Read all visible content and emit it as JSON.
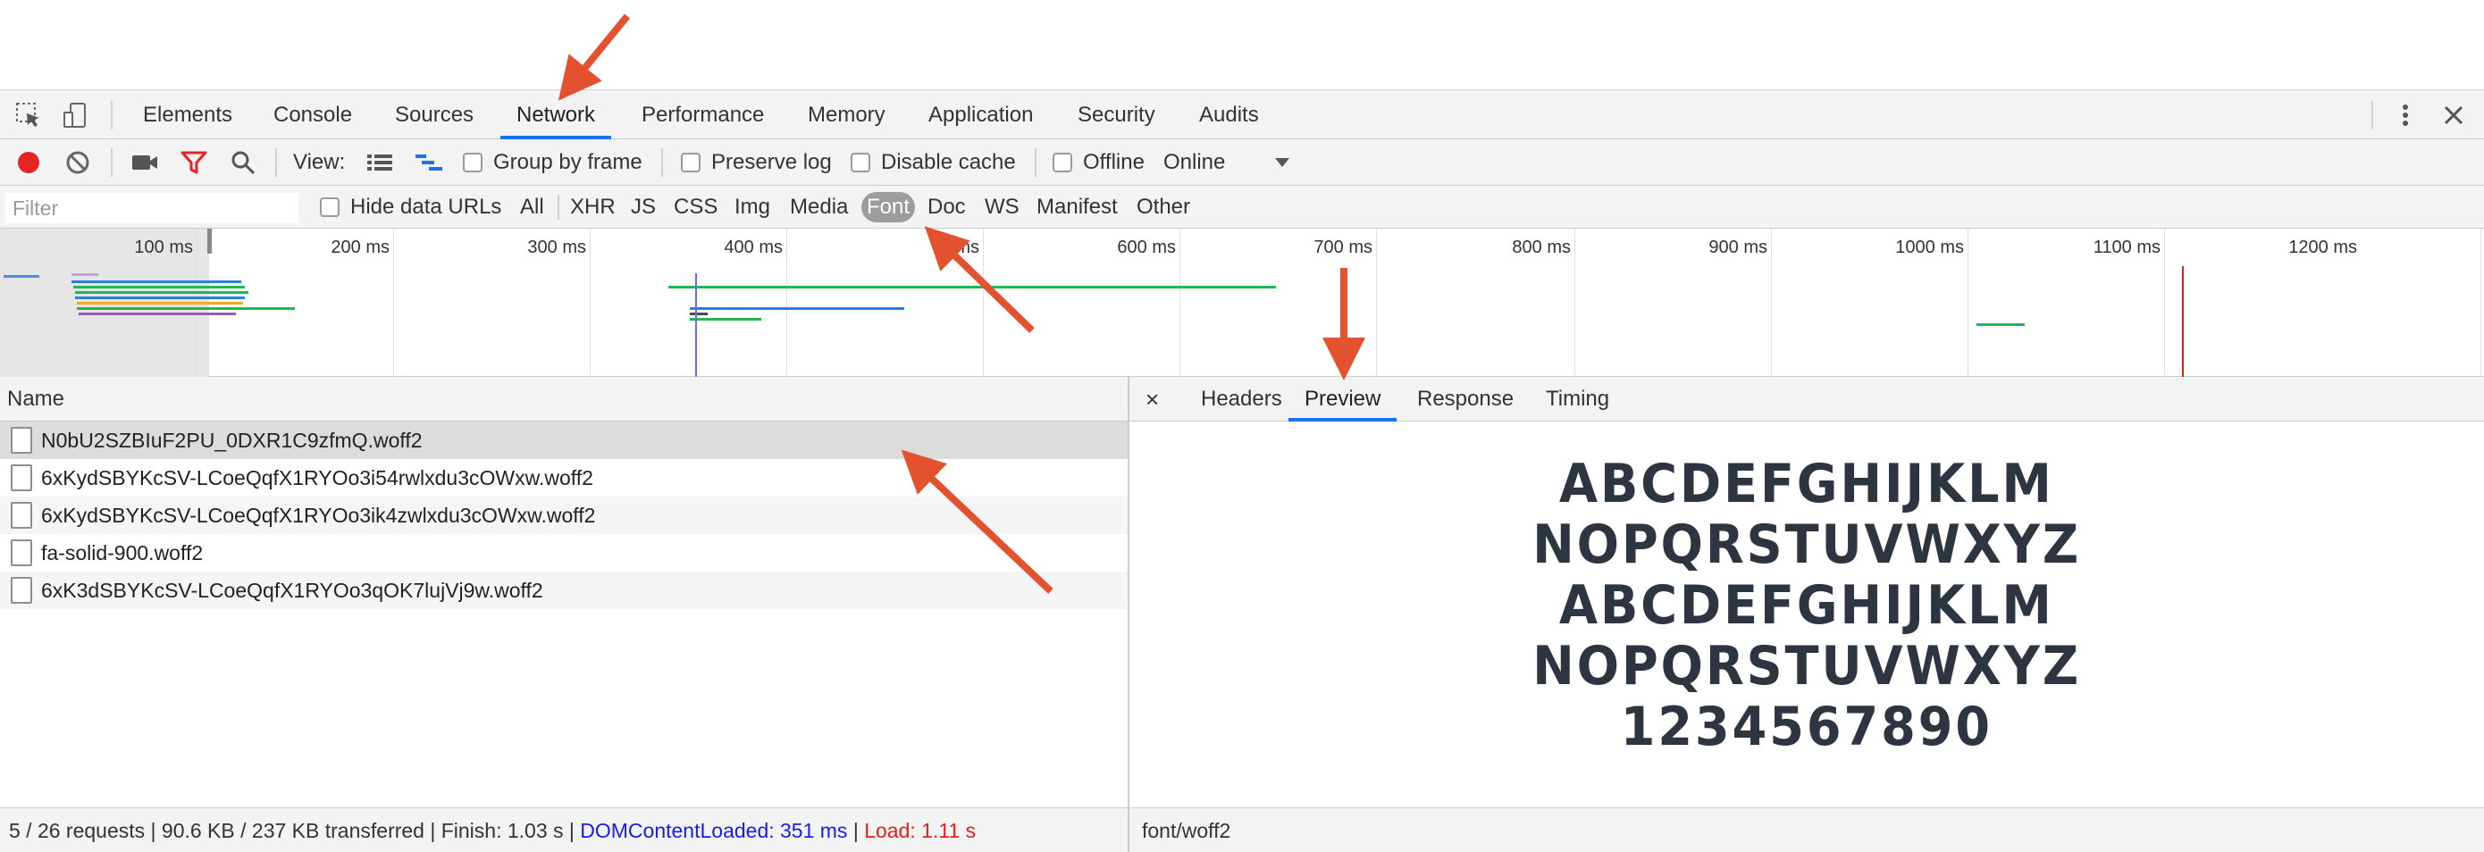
{
  "colors": {
    "accent": "#1a73e8",
    "arrow": "#e4512f",
    "record": "#e52424",
    "filter_active": "#e52424"
  },
  "icons": [
    "inspect-icon",
    "device-toggle-icon",
    "record-icon",
    "clear-icon",
    "camera-icon",
    "filter-icon",
    "search-icon",
    "list-view-icon",
    "waterfall-view-icon",
    "more-vert-icon",
    "close-icon",
    "dropdown-icon",
    "file-icon"
  ],
  "devtools_tabs": [
    "Elements",
    "Console",
    "Sources",
    "Network",
    "Performance",
    "Memory",
    "Application",
    "Security",
    "Audits"
  ],
  "active_tab": "Network",
  "toolbar": {
    "view_label": "View:",
    "group_by_frame": "Group by frame",
    "preserve_log": "Preserve log",
    "disable_cache": "Disable cache",
    "offline": "Offline",
    "throttle": "Online"
  },
  "filter": {
    "placeholder": "Filter",
    "hide_data_urls": "Hide data URLs",
    "types": [
      "All",
      "XHR",
      "JS",
      "CSS",
      "Img",
      "Media",
      "Font",
      "Doc",
      "WS",
      "Manifest",
      "Other"
    ],
    "active_type": "Font"
  },
  "timeline": {
    "labels": [
      "100 ms",
      "200 ms",
      "300 ms",
      "400 ms",
      "ms",
      "600 ms",
      "700 ms",
      "800 ms",
      "900 ms",
      "1000 ms",
      "1100 ms",
      "1200 ms"
    ]
  },
  "requests": {
    "header": "Name",
    "items": [
      "N0bU2SZBIuF2PU_0DXR1C9zfmQ.woff2",
      "6xKydSBYKcSV-LCoeQqfX1RYOo3i54rwlxdu3cOWxw.woff2",
      "6xKydSBYKcSV-LCoeQqfX1RYOo3ik4zwlxdu3cOWxw.woff2",
      "fa-solid-900.woff2",
      "6xK3dSBYKcSV-LCoeQqfX1RYOo3qOK7lujVj9w.woff2"
    ],
    "selected_index": 0
  },
  "detail": {
    "close": "×",
    "tabs": [
      "Headers",
      "Preview",
      "Response",
      "Timing"
    ],
    "active_tab": "Preview",
    "preview_lines": [
      "ABCDEFGHIJKLM",
      "NOPQRSTUVWXYZ",
      "ABCDEFGHIJKLM",
      "NOPQRSTUVWXYZ",
      "1234567890"
    ],
    "mime": "font/woff2"
  },
  "status": {
    "summary": "5 / 26 requests | 90.6 KB / 237 KB transferred | Finish: 1.03 s | ",
    "dom_content_loaded": "DOMContentLoaded: 351 ms",
    "separator": " | ",
    "load": "Load: 1.11 s"
  }
}
